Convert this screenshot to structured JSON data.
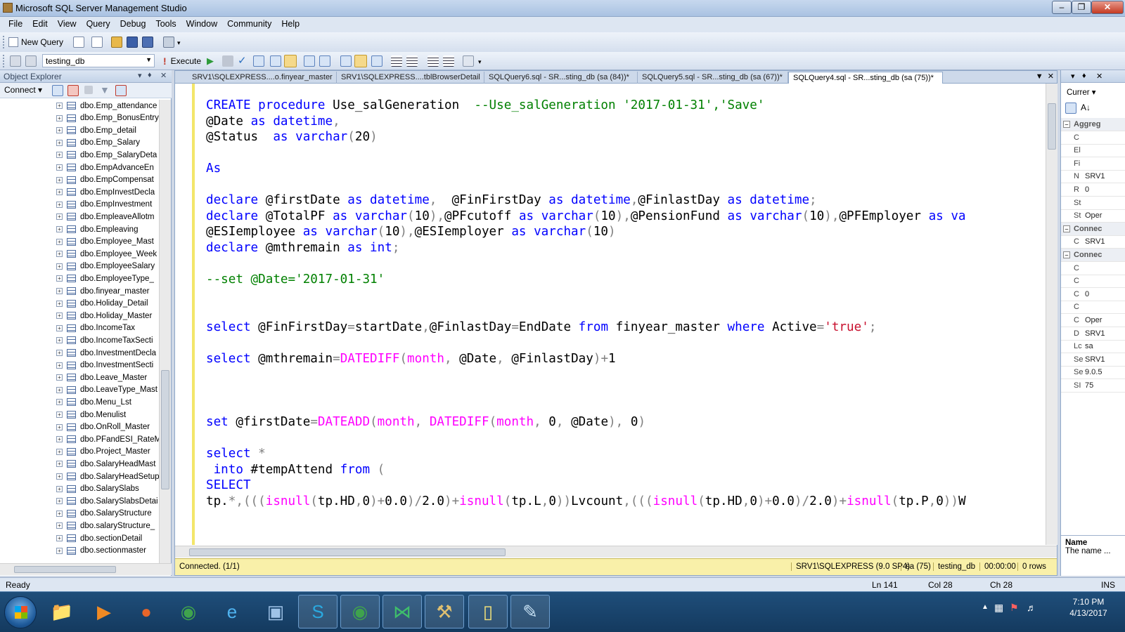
{
  "window": {
    "title": "Microsoft SQL Server Management Studio"
  },
  "menu": [
    "File",
    "Edit",
    "View",
    "Query",
    "Debug",
    "Tools",
    "Window",
    "Community",
    "Help"
  ],
  "toolbar": {
    "new_query": "New Query",
    "database": "testing_db",
    "execute": "Execute"
  },
  "object_explorer": {
    "title": "Object Explorer",
    "connect": "Connect ▾",
    "items": [
      "dbo.Emp_attendance",
      "dbo.Emp_BonusEntry",
      "dbo.Emp_detail",
      "dbo.Emp_Salary",
      "dbo.Emp_SalaryDeta",
      "dbo.EmpAdvanceEn",
      "dbo.EmpCompensat",
      "dbo.EmpInvestDecla",
      "dbo.EmpInvestment",
      "dbo.EmpleaveAllotm",
      "dbo.Empleaving",
      "dbo.Employee_Mast",
      "dbo.Employee_Week",
      "dbo.EmployeeSalary",
      "dbo.EmployeeType_",
      "dbo.finyear_master",
      "dbo.Holiday_Detail",
      "dbo.Holiday_Master",
      "dbo.IncomeTax",
      "dbo.IncomeTaxSecti",
      "dbo.InvestmentDecla",
      "dbo.InvestmentSecti",
      "dbo.Leave_Master",
      "dbo.LeaveType_Mast",
      "dbo.Menu_Lst",
      "dbo.Menulist",
      "dbo.OnRoll_Master",
      "dbo.PFandESI_RateM",
      "dbo.Project_Master",
      "dbo.SalaryHeadMast",
      "dbo.SalaryHeadSetup",
      "dbo.SalarySlabs",
      "dbo.SalarySlabsDetai",
      "dbo.SalaryStructure",
      "dbo.salaryStructure_",
      "dbo.sectionDetail",
      "dbo.sectionmaster"
    ]
  },
  "tabs": [
    {
      "label": "SRV1\\SQLEXPRESS....o.finyear_master"
    },
    {
      "label": "SRV1\\SQLEXPRESS....tblBrowserDetail"
    },
    {
      "label": "SQLQuery6.sql - SR...sting_db (sa (84))*"
    },
    {
      "label": "SQLQuery5.sql - SR...sting_db (sa (67))*"
    },
    {
      "label": "SQLQuery4.sql - SR...sting_db (sa (75))*"
    }
  ],
  "code_lines": [
    [
      [
        "k",
        "CREATE"
      ],
      [
        "t",
        " "
      ],
      [
        "k",
        "procedure"
      ],
      [
        "t",
        " Use_salGeneration  "
      ],
      [
        "c",
        "--Use_salGeneration '2017-01-31','Save'"
      ]
    ],
    [
      [
        "t",
        "@Date "
      ],
      [
        "k",
        "as"
      ],
      [
        "t",
        " "
      ],
      [
        "k",
        "datetime"
      ],
      [
        "g",
        ","
      ]
    ],
    [
      [
        "t",
        "@Status  "
      ],
      [
        "k",
        "as"
      ],
      [
        "t",
        " "
      ],
      [
        "k",
        "varchar"
      ],
      [
        "g",
        "("
      ],
      [
        "t",
        "20"
      ],
      [
        "g",
        ")"
      ]
    ],
    [],
    [
      [
        "k",
        "As"
      ]
    ],
    [],
    [
      [
        "k",
        "declare"
      ],
      [
        "t",
        " @firstDate "
      ],
      [
        "k",
        "as"
      ],
      [
        "t",
        " "
      ],
      [
        "k",
        "datetime"
      ],
      [
        "g",
        ","
      ],
      [
        "t",
        "  @FinFirstDay "
      ],
      [
        "k",
        "as"
      ],
      [
        "t",
        " "
      ],
      [
        "k",
        "datetime"
      ],
      [
        "g",
        ","
      ],
      [
        "t",
        "@FinlastDay "
      ],
      [
        "k",
        "as"
      ],
      [
        "t",
        " "
      ],
      [
        "k",
        "datetime"
      ],
      [
        "g",
        ";"
      ]
    ],
    [
      [
        "k",
        "declare"
      ],
      [
        "t",
        " @TotalPF "
      ],
      [
        "k",
        "as"
      ],
      [
        "t",
        " "
      ],
      [
        "k",
        "varchar"
      ],
      [
        "g",
        "("
      ],
      [
        "t",
        "10"
      ],
      [
        "g",
        "),"
      ],
      [
        "t",
        "@PFcutoff "
      ],
      [
        "k",
        "as"
      ],
      [
        "t",
        " "
      ],
      [
        "k",
        "varchar"
      ],
      [
        "g",
        "("
      ],
      [
        "t",
        "10"
      ],
      [
        "g",
        "),"
      ],
      [
        "t",
        "@PensionFund "
      ],
      [
        "k",
        "as"
      ],
      [
        "t",
        " "
      ],
      [
        "k",
        "varchar"
      ],
      [
        "g",
        "("
      ],
      [
        "t",
        "10"
      ],
      [
        "g",
        "),"
      ],
      [
        "t",
        "@PFEmployer "
      ],
      [
        "k",
        "as"
      ],
      [
        "t",
        " "
      ],
      [
        "k",
        "va"
      ]
    ],
    [
      [
        "t",
        "@ESIemployee "
      ],
      [
        "k",
        "as"
      ],
      [
        "t",
        " "
      ],
      [
        "k",
        "varchar"
      ],
      [
        "g",
        "("
      ],
      [
        "t",
        "10"
      ],
      [
        "g",
        "),"
      ],
      [
        "t",
        "@ESIemployer "
      ],
      [
        "k",
        "as"
      ],
      [
        "t",
        " "
      ],
      [
        "k",
        "varchar"
      ],
      [
        "g",
        "("
      ],
      [
        "t",
        "10"
      ],
      [
        "g",
        ")"
      ]
    ],
    [
      [
        "k",
        "declare"
      ],
      [
        "t",
        " @mthremain "
      ],
      [
        "k",
        "as"
      ],
      [
        "t",
        " "
      ],
      [
        "k",
        "int"
      ],
      [
        "g",
        ";"
      ]
    ],
    [],
    [
      [
        "c",
        "--set @Date='2017-01-31'"
      ]
    ],
    [],
    [],
    [
      [
        "k",
        "select"
      ],
      [
        "t",
        " @FinFirstDay"
      ],
      [
        "g",
        "="
      ],
      [
        "t",
        "startDate"
      ],
      [
        "g",
        ","
      ],
      [
        "t",
        "@FinlastDay"
      ],
      [
        "g",
        "="
      ],
      [
        "t",
        "EndDate "
      ],
      [
        "k",
        "from"
      ],
      [
        "t",
        " finyear_master "
      ],
      [
        "k",
        "where"
      ],
      [
        "t",
        " Active"
      ],
      [
        "g",
        "="
      ],
      [
        "s",
        "'true'"
      ],
      [
        "g",
        ";"
      ]
    ],
    [],
    [
      [
        "k",
        "select"
      ],
      [
        "t",
        " @mthremain"
      ],
      [
        "g",
        "="
      ],
      [
        "f",
        "DATEDIFF"
      ],
      [
        "g",
        "("
      ],
      [
        "f",
        "month"
      ],
      [
        "g",
        ","
      ],
      [
        "t",
        " @Date"
      ],
      [
        "g",
        ","
      ],
      [
        "t",
        " @FinlastDay"
      ],
      [
        "g",
        ")+"
      ],
      [
        "t",
        "1"
      ]
    ],
    [],
    [],
    [],
    [
      [
        "k",
        "set"
      ],
      [
        "t",
        " @firstDate"
      ],
      [
        "g",
        "="
      ],
      [
        "f",
        "DATEADD"
      ],
      [
        "g",
        "("
      ],
      [
        "f",
        "month"
      ],
      [
        "g",
        ","
      ],
      [
        "t",
        " "
      ],
      [
        "f",
        "DATEDIFF"
      ],
      [
        "g",
        "("
      ],
      [
        "f",
        "month"
      ],
      [
        "g",
        ","
      ],
      [
        "t",
        " 0"
      ],
      [
        "g",
        ","
      ],
      [
        "t",
        " @Date"
      ],
      [
        "g",
        "),"
      ],
      [
        "t",
        " 0"
      ],
      [
        "g",
        ")"
      ]
    ],
    [],
    [
      [
        "k",
        "select"
      ],
      [
        "t",
        " "
      ],
      [
        "g",
        "*"
      ]
    ],
    [
      [
        "t",
        " "
      ],
      [
        "k",
        "into"
      ],
      [
        "t",
        " #tempAttend "
      ],
      [
        "k",
        "from"
      ],
      [
        "t",
        " "
      ],
      [
        "g",
        "("
      ]
    ],
    [
      [
        "k",
        "SELECT"
      ]
    ],
    [
      [
        "t",
        "tp."
      ],
      [
        "g",
        "*,((("
      ],
      [
        "f",
        "isnull"
      ],
      [
        "g",
        "("
      ],
      [
        "t",
        "tp.HD"
      ],
      [
        "g",
        ","
      ],
      [
        "t",
        "0"
      ],
      [
        "g",
        ")+"
      ],
      [
        "t",
        "0.0"
      ],
      [
        "g",
        ")/"
      ],
      [
        "t",
        "2.0"
      ],
      [
        "g",
        ")+"
      ],
      [
        "f",
        "isnull"
      ],
      [
        "g",
        "("
      ],
      [
        "t",
        "tp.L"
      ],
      [
        "g",
        ","
      ],
      [
        "t",
        "0"
      ],
      [
        "g",
        "))"
      ],
      [
        "t",
        "Lvcount"
      ],
      [
        "g",
        ",((("
      ],
      [
        "f",
        "isnull"
      ],
      [
        "g",
        "("
      ],
      [
        "t",
        "tp.HD"
      ],
      [
        "g",
        ","
      ],
      [
        "t",
        "0"
      ],
      [
        "g",
        ")+"
      ],
      [
        "t",
        "0.0"
      ],
      [
        "g",
        ")/"
      ],
      [
        "t",
        "2.0"
      ],
      [
        "g",
        ")+"
      ],
      [
        "f",
        "isnull"
      ],
      [
        "g",
        "("
      ],
      [
        "t",
        "tp.P"
      ],
      [
        "g",
        ","
      ],
      [
        "t",
        "0"
      ],
      [
        "g",
        "))"
      ],
      [
        "t",
        "W"
      ]
    ]
  ],
  "query_status": {
    "connected": "Connected. (1/1)",
    "server": "SRV1\\SQLEXPRESS (9.0 SP4)",
    "user": "sa (75)",
    "database": "testing_db",
    "time": "00:00:00",
    "rows": "0 rows"
  },
  "properties": {
    "combo": "Currer ▾",
    "rows": [
      {
        "type": "cat",
        "text": "Aggreg"
      },
      {
        "k": "C",
        "v": ""
      },
      {
        "k": "El",
        "v": ""
      },
      {
        "k": "Fi",
        "v": ""
      },
      {
        "k": "N",
        "v": "SRV1"
      },
      {
        "k": "R",
        "v": "0"
      },
      {
        "k": "St",
        "v": ""
      },
      {
        "k": "St",
        "v": "Oper"
      },
      {
        "type": "cat",
        "text": "Connec"
      },
      {
        "k": "C",
        "v": "SRV1"
      },
      {
        "type": "cat",
        "text": "Connec"
      },
      {
        "k": "C",
        "v": ""
      },
      {
        "k": "C",
        "v": ""
      },
      {
        "k": "C",
        "v": "0"
      },
      {
        "k": "C",
        "v": ""
      },
      {
        "k": "C",
        "v": "Oper"
      },
      {
        "k": "D",
        "v": "SRV1"
      },
      {
        "k": "Lc",
        "v": "sa"
      },
      {
        "k": "Se",
        "v": "SRV1"
      },
      {
        "k": "Se",
        "v": "9.0.5"
      },
      {
        "k": "SI",
        "v": "75"
      }
    ],
    "desc_title": "Name",
    "desc_text": "The name ..."
  },
  "statusbar": {
    "ready": "Ready",
    "ln": "Ln 141",
    "col": "Col 28",
    "ch": "Ch 28",
    "ins": "INS"
  },
  "clock": {
    "time": "7:10 PM",
    "date": "4/13/2017"
  }
}
